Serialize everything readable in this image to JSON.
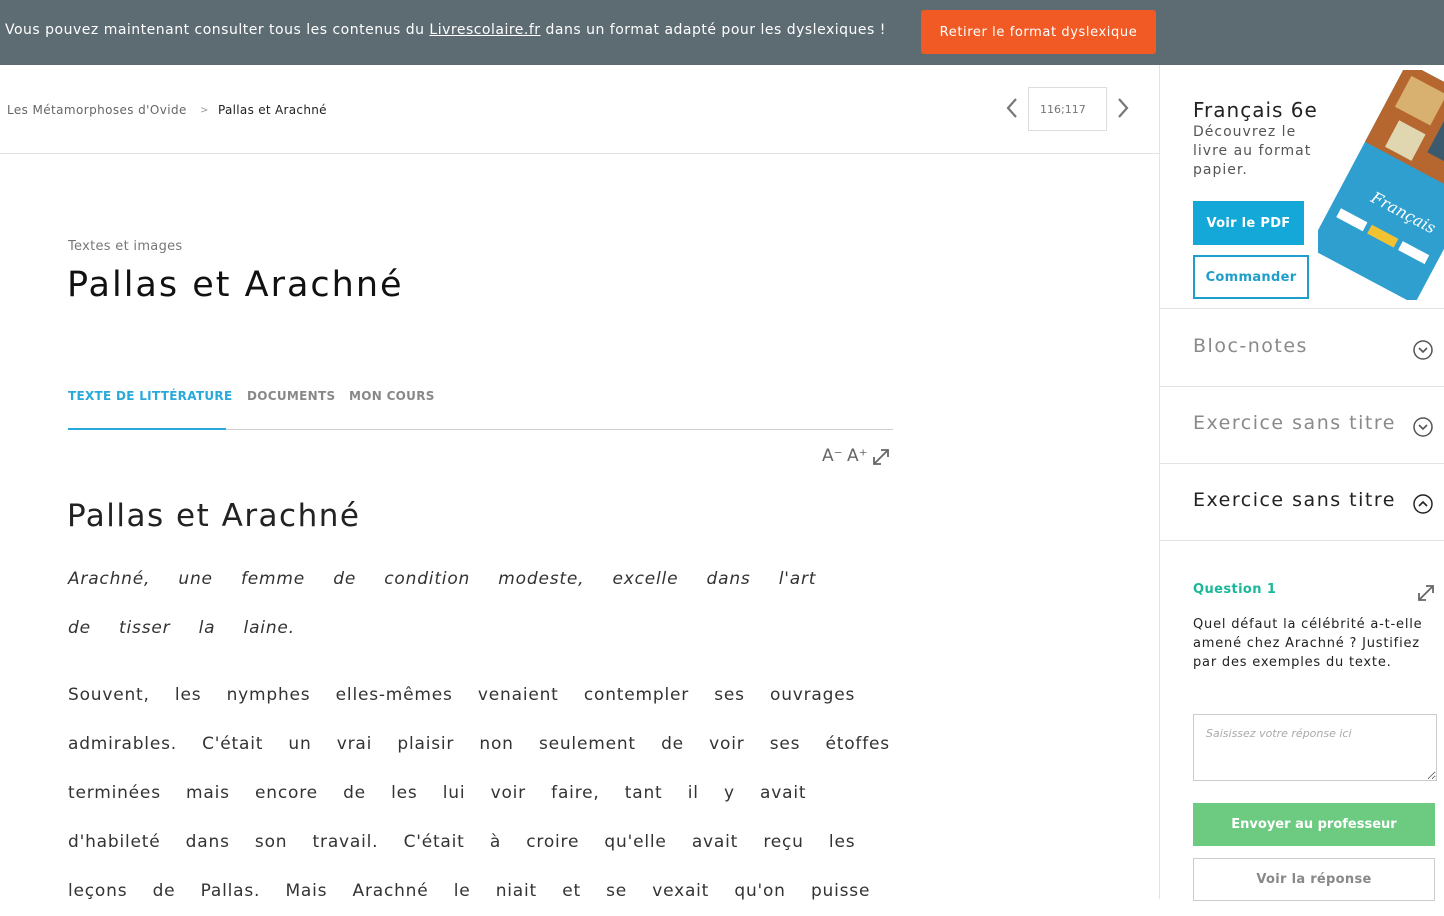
{
  "banner": {
    "text_before": "Vous pouvez maintenant consulter tous les contenus du ",
    "link": "Livrescolaire.fr",
    "text_after": " dans un format adapté pour les dyslexiques !",
    "button_label": "Retirer le format dyslexique"
  },
  "breadcrumb": {
    "parent": "Les Métamorphoses d'Ovide",
    "separator": ">",
    "current": "Pallas et Arachné"
  },
  "pager": {
    "value": "116;117"
  },
  "header": {
    "kicker": "Textes et images",
    "title": "Pallas et Arachné"
  },
  "tabs": [
    {
      "label": "TEXTE DE LITTÉRATURE",
      "active": true
    },
    {
      "label": "DOCUMENTS",
      "active": false
    },
    {
      "label": "MON COURS",
      "active": false
    }
  ],
  "font_tools": {
    "decrease": "A⁻",
    "increase": "A⁺"
  },
  "content": {
    "section_title": "Pallas et Arachné",
    "intro": "Arachné, une femme de condition modeste, excelle dans l'art de tisser la laine.",
    "paragraph": "Souvent, les nymphes elles-mêmes venaient contempler ses ouvrages admirables. C'était un vrai plaisir non seulement de voir ses étoffes terminées mais encore de les lui voir faire, tant il y avait d'habileté dans son travail. C'était à croire qu'elle avait reçu les leçons de Pallas. Mais Arachné le niait et se vexait qu'on puisse"
  },
  "sidebar": {
    "promo": {
      "title": "Français 6e",
      "subtitle": "Découvrez le livre au format papier.",
      "pdf_button": "Voir le PDF",
      "order_button": "Commander",
      "book_cover_text": "Français"
    },
    "accordions": [
      {
        "title": "Bloc-notes",
        "expanded": false
      },
      {
        "title": "Exercice sans titre",
        "expanded": false
      },
      {
        "title": "Exercice sans titre",
        "expanded": true
      }
    ],
    "question": {
      "label": "Question 1",
      "text": "Quel défaut la célébrité a-t-elle amené chez Arachné ? Justifiez par des exemples du texte.",
      "answer_placeholder": "Saisissez votre réponse ici",
      "send_button": "Envoyer au professeur",
      "show_answer_button": "Voir la réponse"
    }
  },
  "colors": {
    "banner_bg": "#5d6b73",
    "banner_button": "#f15a24",
    "accent_blue": "#29a9d9",
    "question_green": "#1ab79a",
    "send_green": "#6dcb81"
  }
}
